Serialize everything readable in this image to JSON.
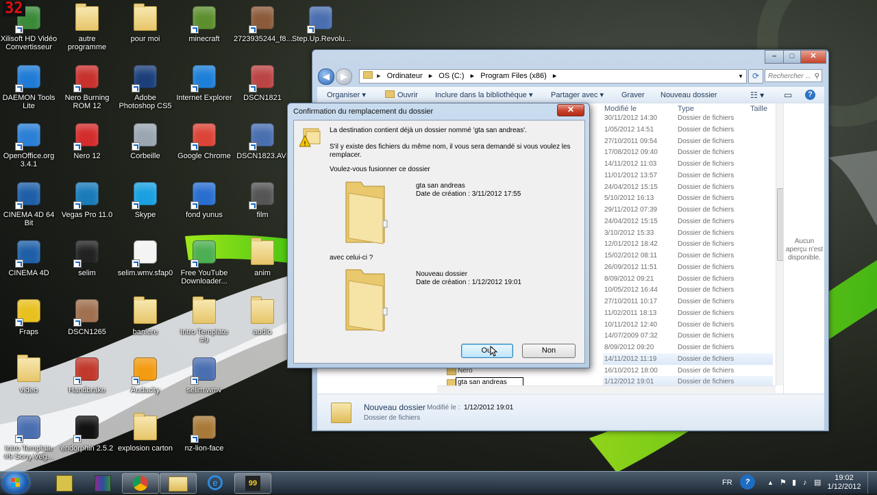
{
  "fps_counter": "32",
  "desktop_icons": [
    {
      "label": "Xilisoft HD Vidéo Convertisseur",
      "icon": "video-converter-icon",
      "color": "#3a8a3a"
    },
    {
      "label": "autre programme",
      "icon": "folder-icon",
      "color": "#e7c56a"
    },
    {
      "label": "pour moi",
      "icon": "folder-icon",
      "color": "#e7c56a"
    },
    {
      "label": "minecraft",
      "icon": "minecraft-icon",
      "color": "#5d8f2f"
    },
    {
      "label": "2723935244_f8...",
      "icon": "image-icon",
      "color": "#8a5a3a"
    },
    {
      "label": "Step.Up.Revolu...",
      "icon": "avi-file-icon",
      "color": "#4a6fb0"
    },
    {
      "label": "DAEMON Tools Lite",
      "icon": "daemon-tools-icon",
      "color": "#1f7bd6"
    },
    {
      "label": "Nero Burning ROM 12",
      "icon": "nero-burning-icon",
      "color": "#c8312d"
    },
    {
      "label": "Adobe Photoshop CS5",
      "icon": "photoshop-icon",
      "color": "#1c3f7a"
    },
    {
      "label": "Internet Explorer",
      "icon": "internet-explorer-icon",
      "color": "#1e7fd8"
    },
    {
      "label": "DSCN1821",
      "icon": "image-icon",
      "color": "#b44"
    },
    {
      "label": "OpenOffice.org 3.4.1",
      "icon": "openoffice-icon",
      "color": "#2b7fd4"
    },
    {
      "label": "Nero 12",
      "icon": "nero-icon",
      "color": "#d32c2c"
    },
    {
      "label": "Corbeille",
      "icon": "recycle-bin-icon",
      "color": "#9aa6b2"
    },
    {
      "label": "Google Chrome",
      "icon": "google-chrome-icon",
      "color": "#db4437"
    },
    {
      "label": "DSCN1823.AVI",
      "icon": "media-file-icon",
      "color": "#4a6fb0"
    },
    {
      "label": "CINEMA 4D 64 Bit",
      "icon": "cinema4d-icon",
      "color": "#1f5fa8"
    },
    {
      "label": "Vegas Pro 11.0",
      "icon": "vegas-pro-icon",
      "color": "#1a7bb9"
    },
    {
      "label": "Skype",
      "icon": "skype-icon",
      "color": "#1aa0e0"
    },
    {
      "label": "fond yunus",
      "icon": "image-icon",
      "color": "#2a6fd0"
    },
    {
      "label": "film",
      "icon": "film-icon",
      "color": "#555"
    },
    {
      "label": "CINEMA 4D",
      "icon": "cinema4d-icon",
      "color": "#1f5fa8"
    },
    {
      "label": "selim",
      "icon": "video-icon",
      "color": "#222"
    },
    {
      "label": "selim.wmv.sfap0",
      "icon": "file-icon",
      "color": "#f4f4f4"
    },
    {
      "label": "Free YouTube Downloader...",
      "icon": "youtube-downloader-icon",
      "color": "#4caf50"
    },
    {
      "label": "anim",
      "icon": "folder-icon",
      "color": "#e7c56a"
    },
    {
      "label": "Fraps",
      "icon": "fraps-icon",
      "color": "#e8c020"
    },
    {
      "label": "DSCN1265",
      "icon": "image-icon",
      "color": "#a07050"
    },
    {
      "label": "baniere",
      "icon": "folder-icon",
      "color": "#e7c56a"
    },
    {
      "label": "Intro Template #9",
      "icon": "folder-icon",
      "color": "#e7c56a"
    },
    {
      "label": "audio",
      "icon": "folder-icon",
      "color": "#e7c56a"
    },
    {
      "label": "video",
      "icon": "folder-icon",
      "color": "#e7c56a"
    },
    {
      "label": "Handbrake",
      "icon": "handbrake-icon",
      "color": "#c0392b"
    },
    {
      "label": "Audacity",
      "icon": "audacity-icon",
      "color": "#f39c12"
    },
    {
      "label": "selim.wmv",
      "icon": "media-file-icon",
      "color": "#4a6fb0"
    },
    {
      "label": "Intro Template #9 Sony Veg...",
      "icon": "media-file-icon",
      "color": "#4a6fb0"
    },
    {
      "label": "endorphin 2.5.2",
      "icon": "endorphin-icon",
      "color": "#111"
    },
    {
      "label": "explosion carton",
      "icon": "folder-icon",
      "color": "#e7c56a"
    },
    {
      "label": "nz-lion-face",
      "icon": "image-icon",
      "color": "#a87a3a"
    }
  ],
  "explorer": {
    "breadcrumb": [
      "Ordinateur",
      "OS (C:)",
      "Program Files (x86)"
    ],
    "search_placeholder": "Rechercher ...",
    "toolbar": {
      "organiser": "Organiser",
      "ouvrir": "Ouvrir",
      "inclure": "Inclure dans la bibliothèque",
      "partager": "Partager avec",
      "graver": "Graver",
      "nouveau_dossier": "Nouveau dossier"
    },
    "columns": {
      "modifie": "Modifié le",
      "type": "Type",
      "taille": "Taille"
    },
    "rows": [
      {
        "date": "30/11/2012 14:30",
        "type": "Dossier de fichiers"
      },
      {
        "date": "1/05/2012 14:51",
        "type": "Dossier de fichiers"
      },
      {
        "date": "27/10/2011 09:54",
        "type": "Dossier de fichiers"
      },
      {
        "date": "17/08/2012 09:40",
        "type": "Dossier de fichiers"
      },
      {
        "date": "14/11/2012 11:03",
        "type": "Dossier de fichiers"
      },
      {
        "date": "11/01/2012 13:57",
        "type": "Dossier de fichiers"
      },
      {
        "date": "24/04/2012 15:15",
        "type": "Dossier de fichiers"
      },
      {
        "date": "5/10/2012 16:13",
        "type": "Dossier de fichiers"
      },
      {
        "date": "29/11/2012 07:39",
        "type": "Dossier de fichiers"
      },
      {
        "date": "24/04/2012 15:15",
        "type": "Dossier de fichiers"
      },
      {
        "date": "3/10/2012 15:33",
        "type": "Dossier de fichiers"
      },
      {
        "date": "12/01/2012 18:42",
        "type": "Dossier de fichiers"
      },
      {
        "date": "15/02/2012 08:11",
        "type": "Dossier de fichiers"
      },
      {
        "date": "26/09/2012 11:51",
        "type": "Dossier de fichiers"
      },
      {
        "date": "8/09/2012 09:21",
        "type": "Dossier de fichiers"
      },
      {
        "date": "10/05/2012 16:44",
        "type": "Dossier de fichiers"
      },
      {
        "date": "27/10/2011 10:17",
        "type": "Dossier de fichiers"
      },
      {
        "date": "11/02/2011 18:13",
        "type": "Dossier de fichiers"
      },
      {
        "date": "10/11/2012 12:40",
        "type": "Dossier de fichiers"
      },
      {
        "date": "14/07/2009 07:32",
        "type": "Dossier de fichiers"
      },
      {
        "date": "8/09/2012 09:20",
        "type": "Dossier de fichiers"
      },
      {
        "date": "14/11/2012 11:19",
        "type": "Dossier de fichiers"
      },
      {
        "date": "16/10/2012 18:00",
        "type": "Dossier de fichiers"
      },
      {
        "date": "1/12/2012 19:01",
        "type": "Dossier de fichiers"
      }
    ],
    "name_nero": "Nero",
    "rename_value": "gta san andreas",
    "preview_text": "Aucun aperçu n'est disponible.",
    "details": {
      "name": "Nouveau dossier",
      "modified_label": "Modifié le :",
      "modified_value": "1/12/2012 19:01",
      "type": "Dossier de fichiers"
    }
  },
  "dialog": {
    "title": "Confirmation du remplacement du dossier",
    "line1": "La destination contient déjà un dossier nommé 'gta san andreas'.",
    "line2a": "S'il y existe des fichiers du même nom, il vous sera demandé si vous voulez les",
    "line2b": "remplacer.",
    "question": "Voulez-vous fusionner ce dossier",
    "folder1_name": "gta san andreas",
    "folder1_date": "Date de création : 3/11/2012 17:55",
    "with_label": "avec celui-ci ?",
    "folder2_name": "Nouveau dossier",
    "folder2_date": "Date de création : 1/12/2012 19:01",
    "yes": "Oui",
    "no": "Non"
  },
  "taskbar": {
    "language": "FR",
    "time": "19:02",
    "date": "1/12/2012"
  }
}
